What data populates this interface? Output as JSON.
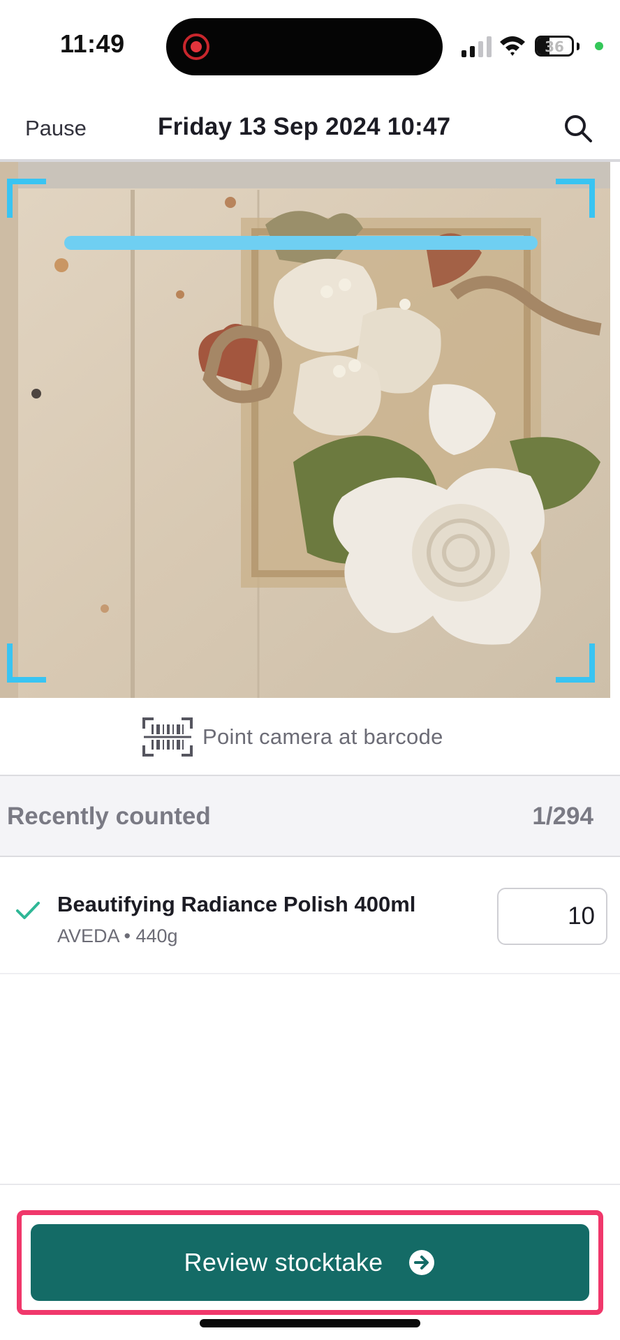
{
  "status_bar": {
    "time": "11:49",
    "battery_level": "36",
    "icons": [
      "screen-recording-icon",
      "cellular-signal-icon",
      "wifi-icon",
      "battery-icon",
      "privacy-indicator-icon"
    ]
  },
  "header": {
    "pause_label": "Pause",
    "title": "Friday 13 Sep 2024 10:47",
    "search_icon": "search-icon"
  },
  "scanner": {
    "frame_color": "#39c4f2",
    "scanline_color": "#6fcff2",
    "hint_text": "Point camera at barcode",
    "hint_icon": "barcode-icon"
  },
  "recently_counted": {
    "title": "Recently counted",
    "count": "1/294",
    "items": [
      {
        "name": "Beautifying Radiance Polish 400ml",
        "meta": "AVEDA • 440g",
        "quantity": "10",
        "status_icon": "check-icon"
      }
    ]
  },
  "footer": {
    "review_label": "Review stocktake",
    "review_icon": "arrow-right-circle-icon",
    "button_color": "#146b66",
    "highlight_color": "#f0386b"
  }
}
